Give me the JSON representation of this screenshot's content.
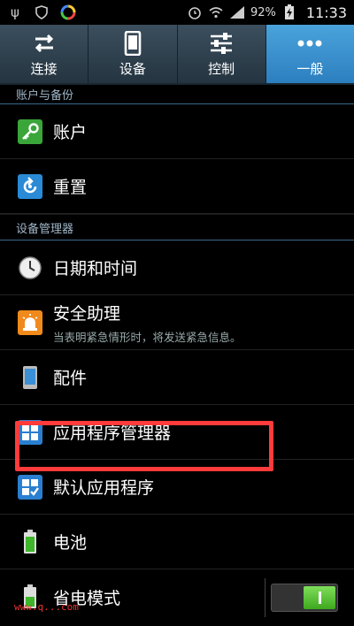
{
  "status_bar": {
    "battery_percent": "92%",
    "time": "11:33"
  },
  "tabs": [
    {
      "label": "连接",
      "icon": "arrows-swap-icon",
      "active": false
    },
    {
      "label": "设备",
      "icon": "phone-icon",
      "active": false
    },
    {
      "label": "控制",
      "icon": "sliders-icon",
      "active": false
    },
    {
      "label": "一般",
      "icon": "more-dots-icon",
      "active": true
    }
  ],
  "sections": {
    "accounts_backup": "账户与备份",
    "device_manager": "设备管理器"
  },
  "items": {
    "account": {
      "title": "账户",
      "icon": "key-icon"
    },
    "reset": {
      "title": "重置",
      "icon": "reset-icon"
    },
    "datetime": {
      "title": "日期和时间",
      "icon": "clock-icon"
    },
    "safety": {
      "title": "安全助理",
      "subtitle": "当表明紧急情形时，将发送紧急信息。",
      "icon": "alarm-light-icon"
    },
    "accessories": {
      "title": "配件",
      "icon": "device-icon"
    },
    "app_manager": {
      "title": "应用程序管理器",
      "icon": "grid-icon"
    },
    "default_apps": {
      "title": "默认应用程序",
      "icon": "grid-check-icon"
    },
    "battery": {
      "title": "电池",
      "icon": "battery-icon"
    },
    "power_saving": {
      "title": "省电模式",
      "icon": "battery-save-icon",
      "toggle_on": true
    }
  },
  "watermark": "www.q...com",
  "colors": {
    "active_tab": "#2c7fbf",
    "highlight": "#ff3b3b",
    "toggle_on": "#3ea81e"
  }
}
